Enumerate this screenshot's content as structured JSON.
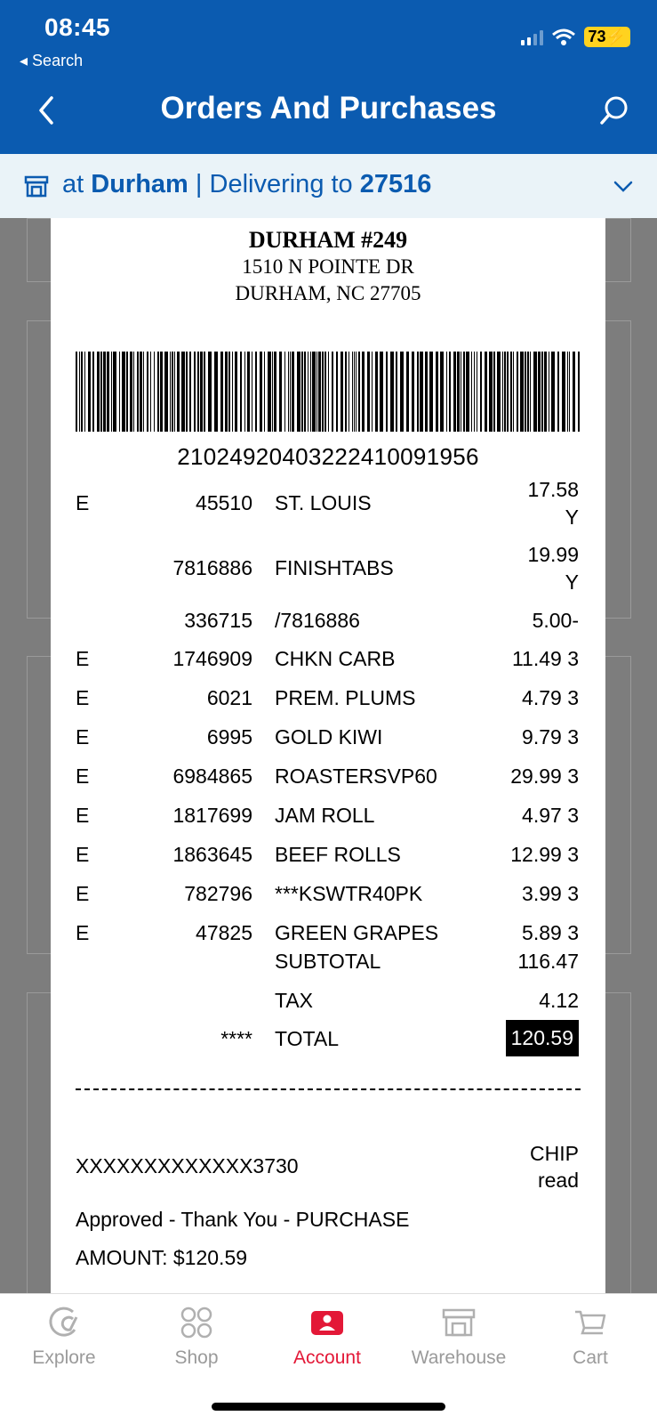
{
  "status": {
    "time": "08:45",
    "back_app": "Search",
    "battery": "73"
  },
  "header": {
    "title": "Orders And Purchases"
  },
  "location": {
    "prefix": "at",
    "store": "Durham",
    "separator": "|",
    "delivering": "Delivering to",
    "zip": "27516"
  },
  "receipt": {
    "store_name": "DURHAM #249",
    "address_line1": "1510 N POINTE DR",
    "address_line2": "DURHAM, NC 27705",
    "barcode_number": "21024920403222410091956",
    "items": [
      {
        "flag": "E",
        "code": "45510",
        "desc": "ST. LOUIS",
        "price": "17.58",
        "sub": "Y"
      },
      {
        "flag": "",
        "code": "7816886",
        "desc": "FINISHTABS",
        "price": "19.99",
        "sub": "Y"
      },
      {
        "flag": "",
        "code": "336715",
        "desc": "/7816886",
        "price": "5.00-"
      },
      {
        "flag": "E",
        "code": "1746909",
        "desc": "CHKN CARB",
        "price": "11.49 3"
      },
      {
        "flag": "E",
        "code": "6021",
        "desc": "PREM. PLUMS",
        "price": "4.79 3"
      },
      {
        "flag": "E",
        "code": "6995",
        "desc": "GOLD KIWI",
        "price": "9.79 3"
      },
      {
        "flag": "E",
        "code": "6984865",
        "desc": "ROASTERSVP60",
        "price": "29.99 3"
      },
      {
        "flag": "E",
        "code": "1817699",
        "desc": "JAM ROLL",
        "price": "4.97 3"
      },
      {
        "flag": "E",
        "code": "1863645",
        "desc": "BEEF ROLLS",
        "price": "12.99 3"
      },
      {
        "flag": "E",
        "code": "782796",
        "desc": "***KSWTR40PK",
        "price": "3.99 3"
      },
      {
        "flag": "E",
        "code": "47825",
        "desc": "GREEN GRAPES",
        "price": "5.89 3"
      }
    ],
    "subtotal_label": "SUBTOTAL",
    "subtotal": "116.47",
    "tax_label": "TAX",
    "tax": "4.12",
    "total_stars": "****",
    "total_label": "TOTAL",
    "total": "120.59",
    "card_number": "XXXXXXXXXXXXX3730",
    "chip_line1": "CHIP",
    "chip_line2": "read",
    "approved": "Approved - Thank You - PURCHASE",
    "amount": "AMOUNT: $120.59"
  },
  "tabs": [
    {
      "label": "Explore",
      "icon": "explore-icon"
    },
    {
      "label": "Shop",
      "icon": "shop-grid-icon"
    },
    {
      "label": "Account",
      "icon": "account-icon",
      "active": true
    },
    {
      "label": "Warehouse",
      "icon": "warehouse-icon"
    },
    {
      "label": "Cart",
      "icon": "cart-icon"
    }
  ],
  "colors": {
    "brand_blue": "#0b5bb0",
    "active_red": "#e31837",
    "battery_yellow": "#ffd21f"
  }
}
